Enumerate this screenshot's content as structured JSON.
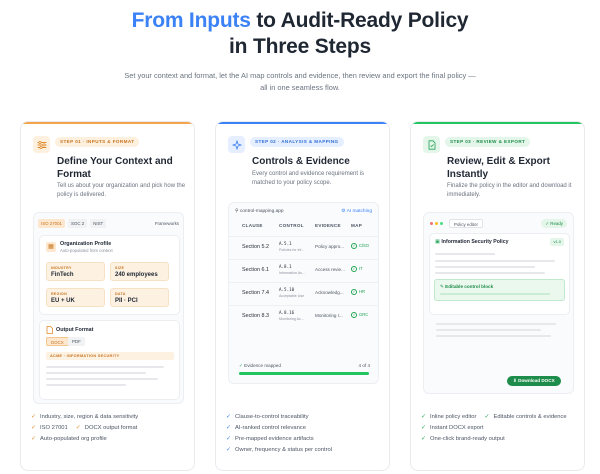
{
  "hero": {
    "title_accent": "From Inputs",
    "title_rest": " to Audit-Ready Policy",
    "title_line2": "in Three Steps",
    "subtitle": "Set your context and format, let the AI map controls and evidence, then review and export the final policy — all in one seamless flow."
  },
  "colors": {
    "accent": "#3b82f6",
    "step1": "#f4a44a",
    "step2": "#3b82f6",
    "step3": "#22c55e"
  },
  "steps": [
    {
      "badge": "STEP 01 · INPUTS & FORMAT",
      "icon": "sliders-icon",
      "title": "Define Your Context and Format",
      "desc": "Tell us about your organization and pick how the policy is delivered.",
      "panel": {
        "chips": [
          "ISO 27001",
          "SOC 2",
          "NIST"
        ],
        "frameworks_label": "Frameworks",
        "org_title": "Organization Profile",
        "org_sub": "Auto-populated from context",
        "fields": [
          {
            "label": "INDUSTRY",
            "value": "FinTech"
          },
          {
            "label": "SIZE",
            "value": "240 employees"
          },
          {
            "label": "REGION",
            "value": "EU + UK"
          },
          {
            "label": "DATA",
            "value": "PII · PCI"
          }
        ],
        "output_title": "Output Format",
        "formats": [
          "DOCX",
          "PDF"
        ],
        "doc_header": "ACME · INFORMATION SECURITY"
      },
      "bullets": [
        [
          "Industry, size, region & data sensitivity"
        ],
        [
          "ISO 27001",
          "DOCX  output format"
        ],
        [
          "Auto-populated org profile"
        ]
      ]
    },
    {
      "badge": "STEP 02 · ANALYSIS & MAPPING",
      "icon": "sparkle-icon",
      "title": "Controls & Evidence",
      "desc": "Every control and evidence requirement is matched to your policy scope.",
      "panel": {
        "search": "control-mapping.app",
        "ai_label": "AI matching",
        "headers": [
          "CLAUSE",
          "CONTROL",
          "EVIDENCE",
          "MAP"
        ],
        "rows": [
          {
            "clause": "Section 5.2",
            "control": "A.5.1",
            "control_sub": "Policies for inf...",
            "evidence": "Policy appro...",
            "map": "ClSO"
          },
          {
            "clause": "Section 6.1",
            "control": "A.8.1",
            "control_sub": "Information As...",
            "evidence": "Access revie...",
            "map": "IT"
          },
          {
            "clause": "Section 7.4",
            "control": "A.5.10",
            "control_sub": "Acceptable Use",
            "evidence": "Acknowledg...",
            "map": "HR"
          },
          {
            "clause": "Section 8.3",
            "control": "A.8.16",
            "control_sub": "Monitoring Ac...",
            "evidence": "Monitoring r...",
            "map": "GRC"
          }
        ],
        "evidence_label": "Evidence mapped",
        "evidence_count": "4 of 4",
        "evidence_progress": 1.0
      },
      "bullets": [
        [
          "Clause-to-control traceability"
        ],
        [
          "AI-ranked control relevance"
        ],
        [
          "Pre-mapped evidence artifacts"
        ],
        [
          "Owner, frequency & status per control"
        ]
      ]
    },
    {
      "badge": "STEP 03 · REVIEW & EXPORT",
      "icon": "document-icon",
      "title": "Review, Edit & Export Instantly",
      "desc": "Finalize the policy in the editor and download it immediately.",
      "panel": {
        "editor_label": "Policy editor",
        "ready_label": "Ready",
        "doc_title": "Information Security Policy",
        "version": "v1.0",
        "editable_block": "Editable control block",
        "download_label": "Download DOCX"
      },
      "bullets": [
        [
          "Inline policy editor",
          "Editable controls & evidence"
        ],
        [
          "Instant DOCX  export"
        ],
        [
          "One-click brand-ready output"
        ]
      ]
    }
  ]
}
